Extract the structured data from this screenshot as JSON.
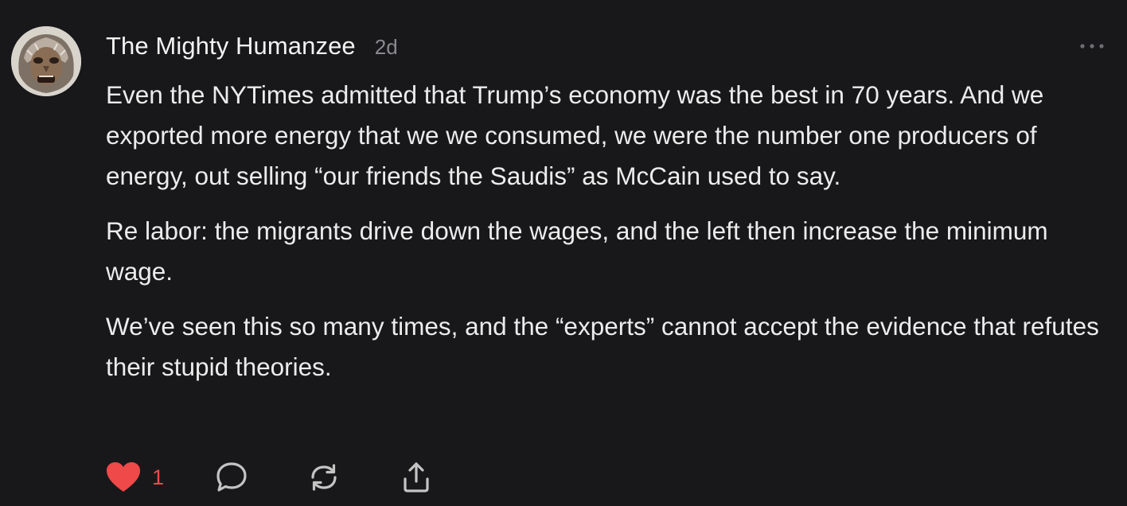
{
  "comment": {
    "author": "The Mighty Humanzee",
    "timestamp": "2d",
    "paragraphs": [
      "Even the NYTimes admitted that Trump’s economy was the best in 70 years. And we exported more energy that we we consumed, we were the number one producers of energy, out selling “our friends the Saudis” as McCain used to say.",
      "Re labor: the migrants drive down the wages, and the left then increase the minimum wage.",
      "We’ve seen this so many times, and the “experts” cannot accept the evidence that refutes their stupid theories."
    ],
    "like_count": "1",
    "liked": true
  },
  "icons": {
    "avatar": "bigfoot-mask-avatar",
    "more": "more-options-icon",
    "like": "heart-icon",
    "reply": "speech-bubble-icon",
    "repost": "repost-arrows-icon",
    "share": "share-upload-icon"
  },
  "colors": {
    "background": "#18181a",
    "text": "#ececec",
    "muted": "#8a8a8e",
    "like": "#ef4949",
    "icon": "#bdbdbd"
  }
}
